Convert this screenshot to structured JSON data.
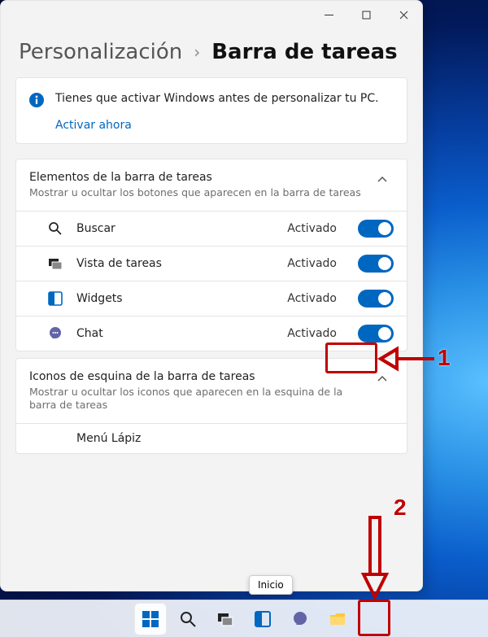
{
  "breadcrumbs": {
    "parent": "Personalización",
    "current": "Barra de tareas"
  },
  "notice": {
    "text": "Tienes que activar Windows antes de personalizar tu PC.",
    "link": "Activar ahora"
  },
  "group1": {
    "title": "Elementos de la barra de tareas",
    "subtitle": "Mostrar u ocultar los botones que aparecen en la barra de tareas",
    "items": [
      {
        "label": "Buscar",
        "state": "Activado"
      },
      {
        "label": "Vista de tareas",
        "state": "Activado"
      },
      {
        "label": "Widgets",
        "state": "Activado"
      },
      {
        "label": "Chat",
        "state": "Activado"
      }
    ]
  },
  "group2": {
    "title": "Iconos de esquina de la barra de tareas",
    "subtitle": "Mostrar u ocultar los iconos que aparecen en la esquina de la barra de tareas",
    "items": [
      {
        "label": "Menú Lápiz"
      }
    ]
  },
  "tooltip": "Inicio",
  "annotations": {
    "label1": "1",
    "label2": "2"
  },
  "colors": {
    "accent": "#0067C0",
    "annotation": "#c00000"
  }
}
